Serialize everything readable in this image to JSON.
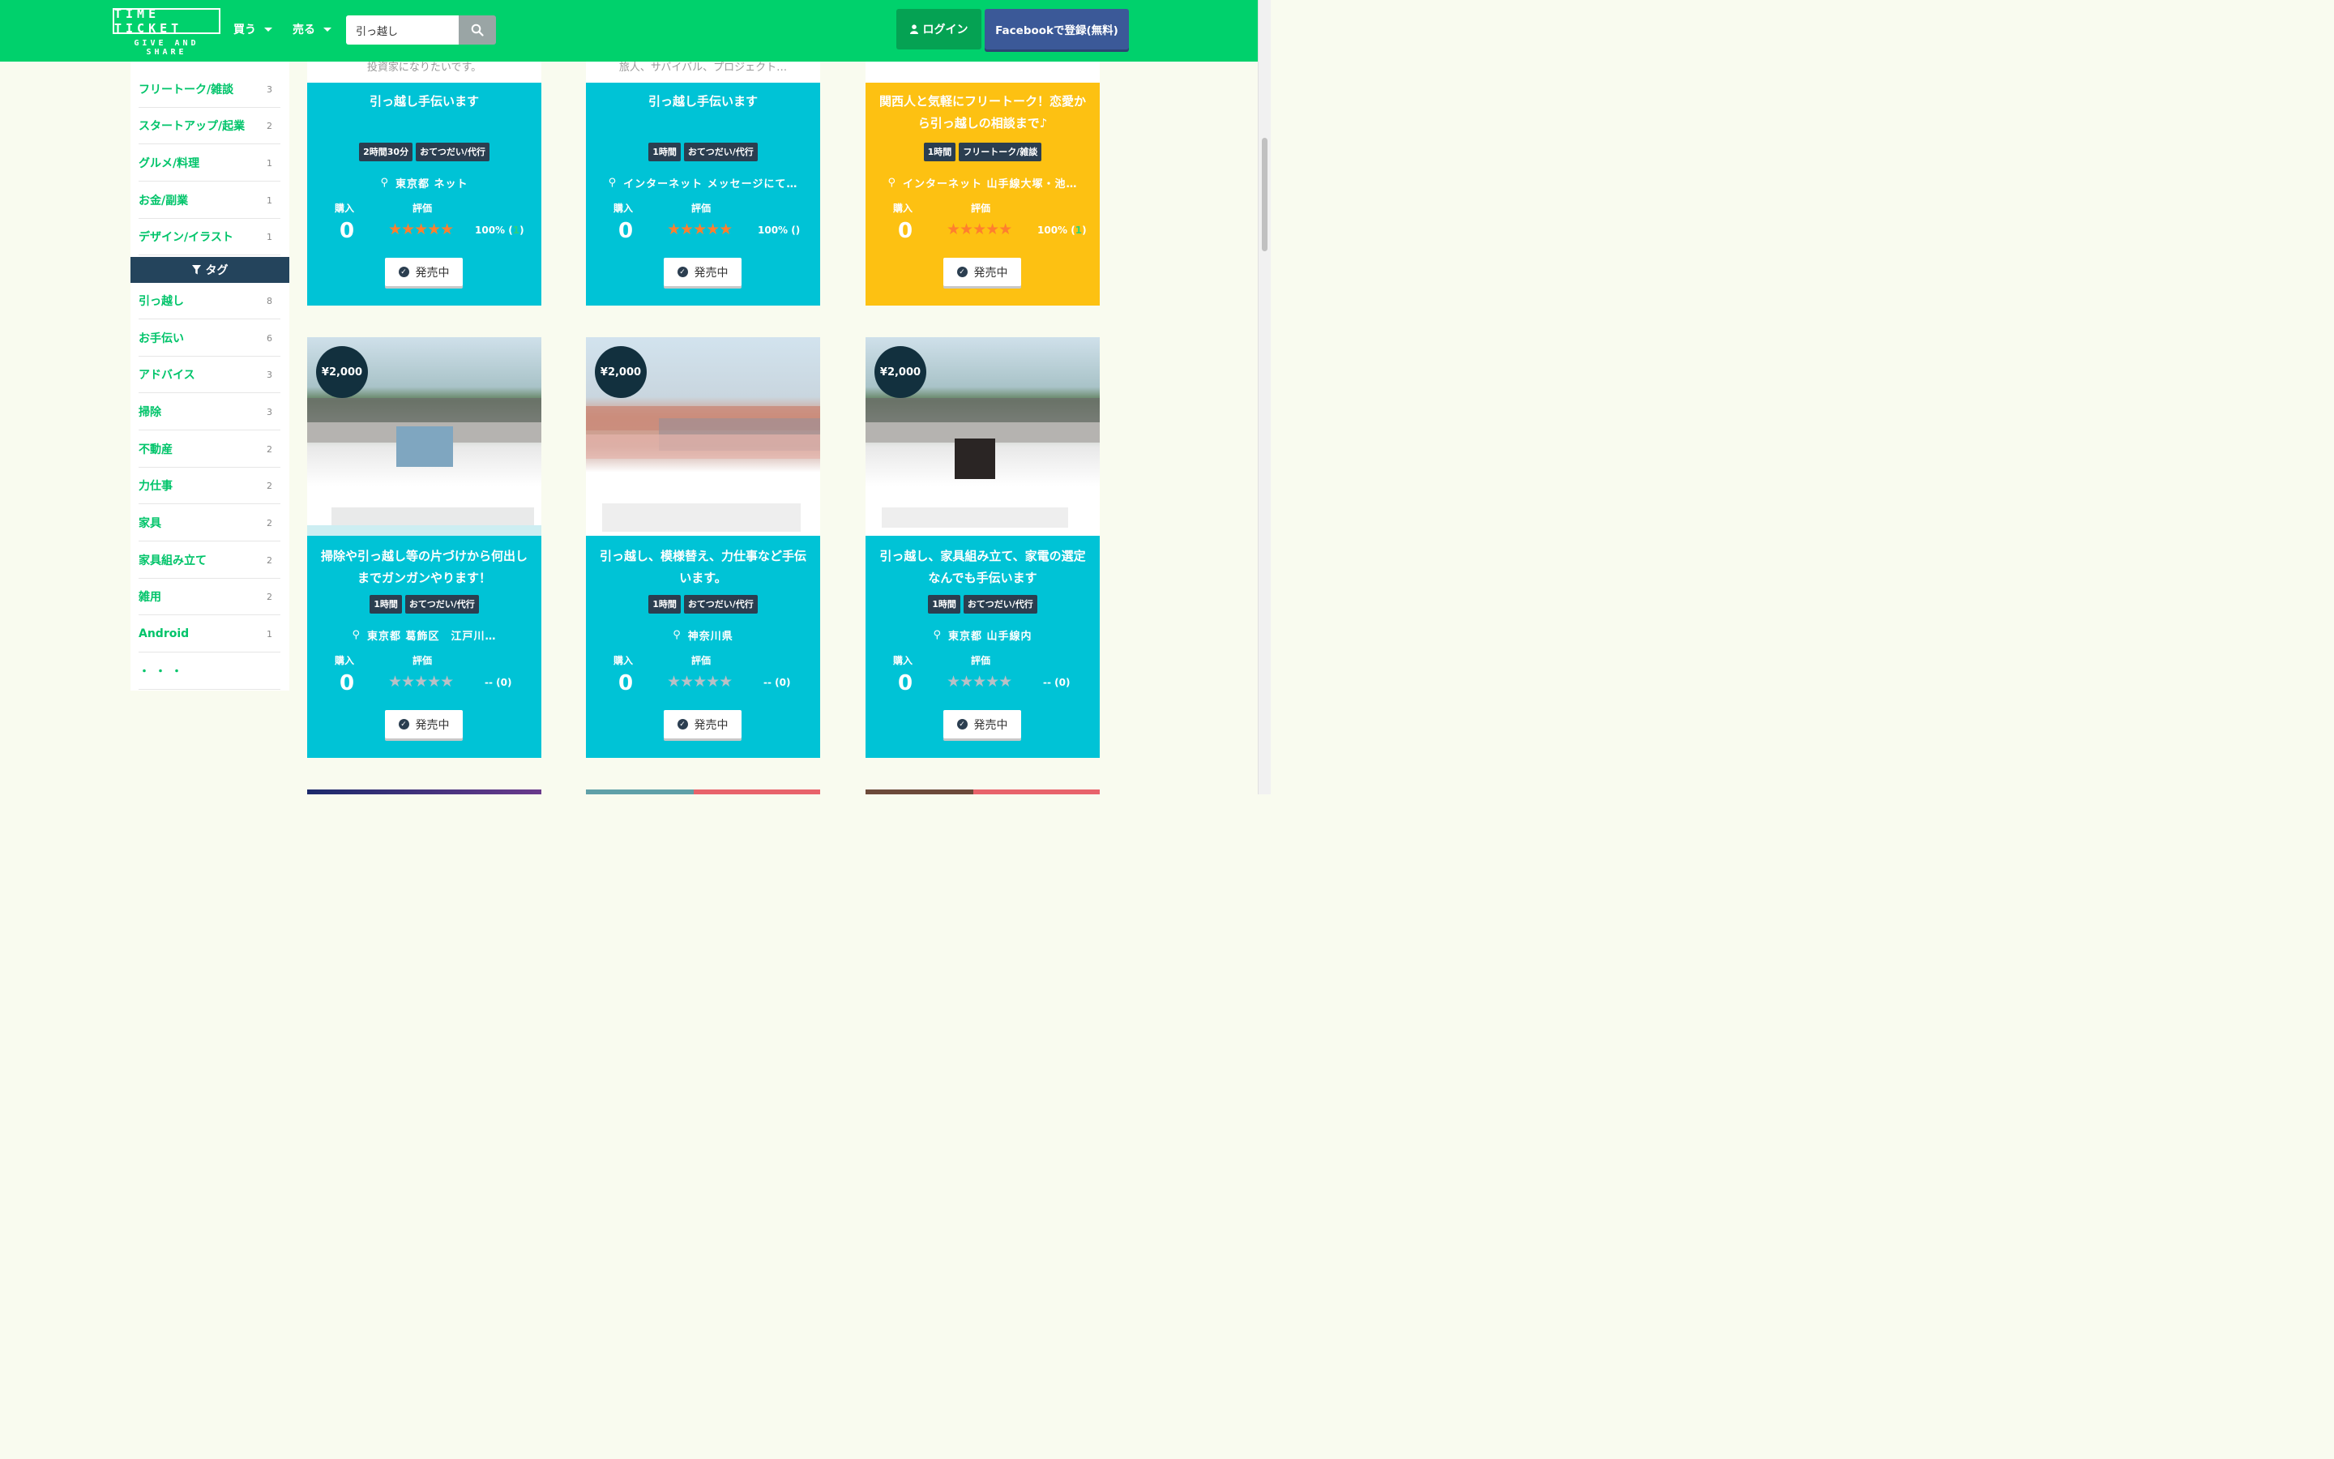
{
  "header": {
    "logo_main": "TIME TICKET",
    "logo_sub": "GIVE AND SHARE",
    "buy_label": "買う",
    "sell_label": "売る",
    "search_value": "引っ越し",
    "login_label": "ログイン",
    "facebook_label": "Facebookで登録(無料)"
  },
  "sidebar": {
    "categories": [
      {
        "label": "フリートーク/雑談",
        "count": "3"
      },
      {
        "label": "スタートアップ/起業",
        "count": "2"
      },
      {
        "label": "グルメ/料理",
        "count": "1"
      },
      {
        "label": "お金/副業",
        "count": "1"
      },
      {
        "label": "デザイン/イラスト",
        "count": "1"
      }
    ],
    "tag_header": "タグ",
    "tags": [
      {
        "label": "引っ越し",
        "count": "8"
      },
      {
        "label": "お手伝い",
        "count": "6"
      },
      {
        "label": "アドバイス",
        "count": "3"
      },
      {
        "label": "掃除",
        "count": "3"
      },
      {
        "label": "不動産",
        "count": "2"
      },
      {
        "label": "力仕事",
        "count": "2"
      },
      {
        "label": "家具",
        "count": "2"
      },
      {
        "label": "家具組み立て",
        "count": "2"
      },
      {
        "label": "雑用",
        "count": "2"
      },
      {
        "label": "Android",
        "count": "1"
      }
    ],
    "more": "・・・"
  },
  "labels": {
    "purchase": "購入",
    "rating": "評価",
    "on_sale": "発売中"
  },
  "row1": [
    {
      "top_text": "投資家になりたいです。",
      "title": "引っ越し手伝います",
      "duration": "2時間30分",
      "category": "おてつだい/代行",
      "location": "東京都 ネット",
      "purchases": "0",
      "rating_pct": "100% (",
      "rating_count": "1",
      "rating_close": ")",
      "stars": 5,
      "color": "#00c3d6"
    },
    {
      "top_text": "旅人、サバイバル、プロジェクト…",
      "title": "引っ越し手伝います",
      "duration": "1時間",
      "category": "おてつだい/代行",
      "location": "インターネット メッセージにて…",
      "purchases": "0",
      "rating_pct": "100% (",
      "rating_count": "",
      "rating_close": ")",
      "stars": 5,
      "color": "#00c3d6"
    },
    {
      "top_text": "",
      "title": "関西人と気軽にフリートーク！恋愛から引っ越しの相談まで♪",
      "duration": "1時間",
      "category": "フリートーク/雑談",
      "location": "インターネット 山手線大塚・池…",
      "purchases": "0",
      "rating_pct": "100% (",
      "rating_count": "1",
      "rating_close": ")",
      "stars": 5,
      "color": "#fdc112"
    }
  ],
  "row2": [
    {
      "price": "¥2,000",
      "title": "掃除や引っ越し等の片づけから何出しまでガンガンやります！",
      "duration": "1時間",
      "category": "おてつだい/代行",
      "location": "東京都 葛飾区　江戸川…",
      "purchases": "0",
      "rating_text": "-- (0)",
      "stars": 0
    },
    {
      "price": "¥2,000",
      "title": "引っ越し、模様替え、力仕事など手伝います。",
      "duration": "1時間",
      "category": "おてつだい/代行",
      "location": "神奈川県",
      "purchases": "0",
      "rating_text": "-- (0)",
      "stars": 0
    },
    {
      "price": "¥2,000",
      "title": "引っ越し、家具組み立て、家電の選定なんでも手伝います",
      "duration": "1時間",
      "category": "おてつだい/代行",
      "location": "東京都 山手線内",
      "purchases": "0",
      "rating_text": "-- (0)",
      "stars": 0
    }
  ],
  "colors": {
    "header_green": "#00d16c",
    "card_cyan": "#00c3d6",
    "card_yellow": "#fdc112",
    "badge_dark": "#2b3e50",
    "star_orange": "#ff7f2e",
    "facebook_blue": "#3b5998"
  },
  "icons": {
    "search": "search-icon",
    "user": "user-icon",
    "filter": "filter-icon",
    "location": "map-marker-icon",
    "check": "check-circle-icon",
    "caret": "caret-down-icon"
  }
}
